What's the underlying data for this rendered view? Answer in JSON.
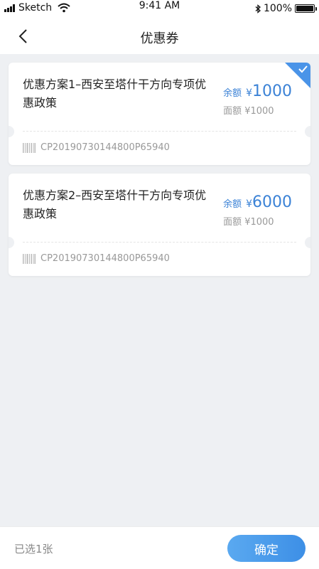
{
  "status_bar": {
    "carrier": "Sketch",
    "time": "9:41 AM",
    "battery": "100%",
    "icons": [
      "signal-icon",
      "wifi-icon",
      "bluetooth-icon",
      "battery-icon"
    ]
  },
  "nav": {
    "title": "优惠券",
    "back_icon": "chevron-left-icon"
  },
  "coupons": [
    {
      "title": "优惠方案1–西安至塔什干方向专项优惠政策",
      "remain_label": "余额",
      "currency": "¥",
      "remain_value": "1000",
      "face_value": "面额 ¥1000",
      "code": "CP20190730144800P65940",
      "selected": true
    },
    {
      "title": "优惠方案2–西安至塔什干方向专项优惠政策",
      "remain_label": "余额",
      "currency": "¥",
      "remain_value": "6000",
      "face_value": "面额 ¥1000",
      "code": "CP20190730144800P65940",
      "selected": false
    }
  ],
  "footer": {
    "selected_count": "已选1张",
    "confirm_label": "确定"
  },
  "colors": {
    "accent": "#3d8fe6",
    "background": "#eef0f3",
    "muted_text": "#999999"
  }
}
